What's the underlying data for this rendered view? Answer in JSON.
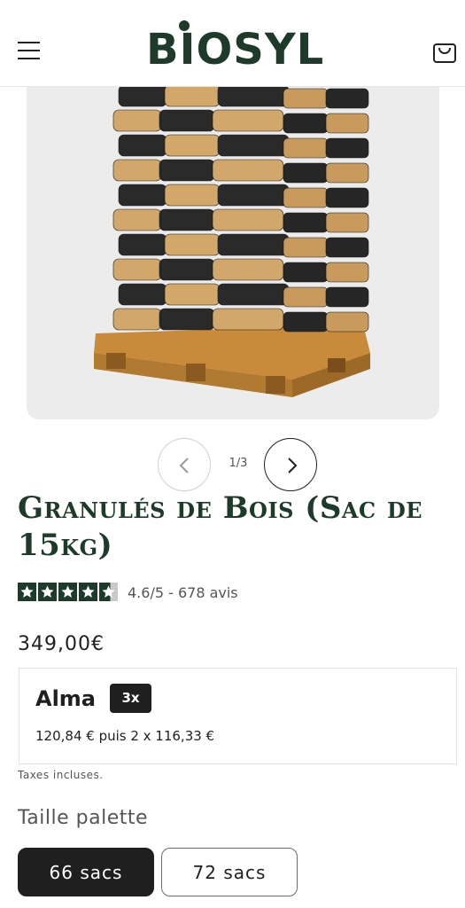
{
  "header": {
    "logo_text": "BIOSYL",
    "menu_icon": "hamburger-menu-icon",
    "cart_icon": "shopping-bag-icon",
    "brand_color": "#1d3a2b"
  },
  "gallery": {
    "image_subject": "pallet-of-wood-pellet-bags",
    "counter": "1/3",
    "prev_icon": "chevron-left-icon",
    "next_icon": "chevron-right-icon"
  },
  "product": {
    "title": "Granulés de Bois (Sac de 15kg)",
    "rating_value": 4.6,
    "rating_text": "4.6/5 - 678 avis",
    "price": "349,00€",
    "taxes_note": "Taxes incluses."
  },
  "alma": {
    "logo": "Alma",
    "badge": "3x",
    "detail": "120,84 € puis 2 x 116,33 €"
  },
  "variant": {
    "label": "Taille palette",
    "options": [
      {
        "label": "66 sacs",
        "selected": true
      },
      {
        "label": "72 sacs",
        "selected": false
      }
    ]
  }
}
